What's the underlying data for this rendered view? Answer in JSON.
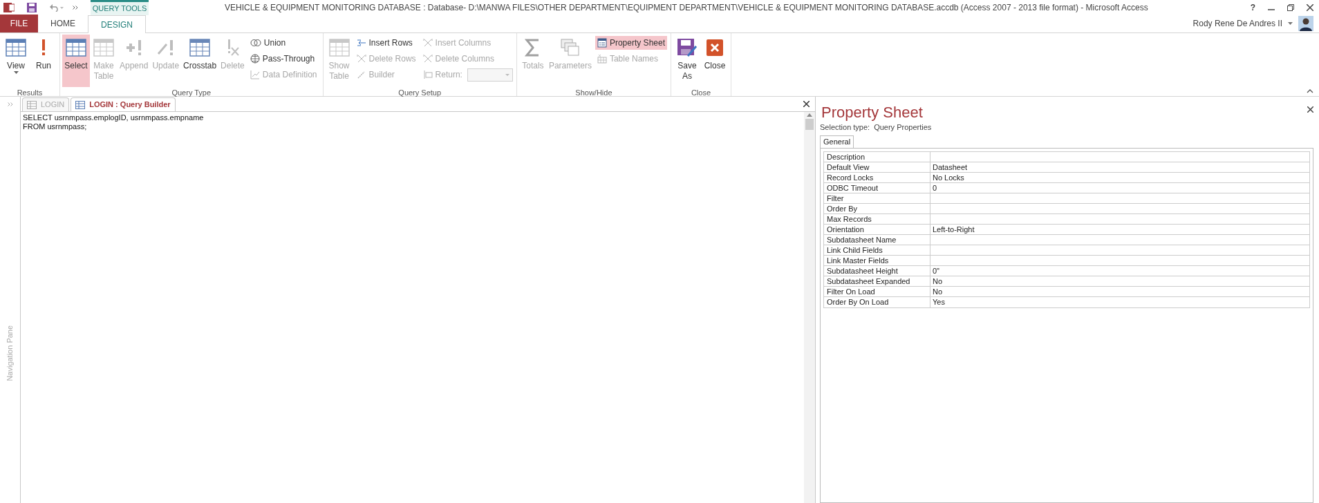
{
  "window": {
    "title": "VEHICLE & EQUIPMENT MONITORING DATABASE : Database- D:\\MANWA FILES\\OTHER DEPARTMENT\\EQUIPMENT DEPARTMENT\\VEHICLE & EQUIPMENT MONITORING DATABASE.accdb (Access 2007 - 2013 file format) - Microsoft Access",
    "context_tab": "QUERY TOOLS",
    "user": "Rody Rene De Andres II",
    "help": "?"
  },
  "ribbon_tabs": [
    {
      "label": "FILE",
      "kind": "file",
      "selected": false
    },
    {
      "label": "HOME",
      "kind": "tab",
      "selected": false
    },
    {
      "label": "DESIGN",
      "kind": "tab",
      "selected": true
    }
  ],
  "ribbon_groups": [
    {
      "label": "Results",
      "items": [
        {
          "kind": "large",
          "label": "View",
          "disabled": false,
          "selected": false,
          "dropdown": true
        },
        {
          "kind": "large",
          "label": "Run",
          "disabled": false,
          "selected": false
        }
      ]
    },
    {
      "label": "Query Type",
      "items": [
        {
          "kind": "large",
          "label": "Select",
          "disabled": false,
          "selected": true
        },
        {
          "kind": "large",
          "label": "Make Table",
          "disabled": true,
          "selected": false
        },
        {
          "kind": "large",
          "label": "Append",
          "disabled": true,
          "selected": false
        },
        {
          "kind": "large",
          "label": "Update",
          "disabled": true,
          "selected": false
        },
        {
          "kind": "large",
          "label": "Crosstab",
          "disabled": false,
          "selected": false
        },
        {
          "kind": "large",
          "label": "Delete",
          "disabled": true,
          "selected": false
        },
        {
          "kind": "stack",
          "items": [
            {
              "label": "Union",
              "disabled": false,
              "selected": false
            },
            {
              "label": "Pass-Through",
              "disabled": false,
              "selected": false
            },
            {
              "label": "Data Definition",
              "disabled": true,
              "selected": false
            }
          ]
        }
      ]
    },
    {
      "label": "Query Setup",
      "items": [
        {
          "kind": "large",
          "label": "Show Table",
          "disabled": true,
          "selected": false
        },
        {
          "kind": "stack",
          "items": [
            {
              "label": "Insert Rows",
              "disabled": false,
              "selected": false
            },
            {
              "label": "Delete Rows",
              "disabled": true,
              "selected": false
            },
            {
              "label": "Builder",
              "disabled": true,
              "selected": false
            }
          ]
        },
        {
          "kind": "stack",
          "items": [
            {
              "label": "Insert Columns",
              "disabled": true,
              "selected": false
            },
            {
              "label": "Delete Columns",
              "disabled": true,
              "selected": false
            },
            {
              "label": "Return:",
              "disabled": true,
              "selected": false,
              "combo": true
            }
          ]
        }
      ]
    },
    {
      "label": "Show/Hide",
      "items": [
        {
          "kind": "large",
          "label": "Totals",
          "disabled": true,
          "selected": false
        },
        {
          "kind": "large",
          "label": "Parameters",
          "disabled": true,
          "selected": false
        },
        {
          "kind": "stack",
          "items": [
            {
              "label": "Property Sheet",
              "disabled": false,
              "selected": true
            },
            {
              "label": "Table Names",
              "disabled": true,
              "selected": false
            }
          ]
        }
      ]
    },
    {
      "label": "Close",
      "items": [
        {
          "kind": "large",
          "label": "Save As",
          "disabled": false,
          "selected": false
        },
        {
          "kind": "large",
          "label": "Close",
          "disabled": false,
          "selected": false
        }
      ]
    }
  ],
  "navigation_pane": {
    "label": "Navigation Pane"
  },
  "document_tabs": [
    {
      "label": "LOGIN",
      "selected": false
    },
    {
      "label": "LOGIN : Query Builder",
      "selected": true
    }
  ],
  "sql_lines": [
    "SELECT usrnmpass.emplogID, usrnmpass.empname",
    "FROM usrnmpass;"
  ],
  "property_sheet": {
    "title": "Property Sheet",
    "selection_label": "Selection type:",
    "selection_value": "Query Properties",
    "tabs": [
      {
        "label": "General",
        "selected": true
      }
    ],
    "rows": [
      {
        "name": "Description",
        "value": ""
      },
      {
        "name": "Default View",
        "value": "Datasheet"
      },
      {
        "name": "Record Locks",
        "value": "No Locks"
      },
      {
        "name": "ODBC Timeout",
        "value": "0"
      },
      {
        "name": "Filter",
        "value": ""
      },
      {
        "name": "Order By",
        "value": ""
      },
      {
        "name": "Max Records",
        "value": ""
      },
      {
        "name": "Orientation",
        "value": "Left-to-Right"
      },
      {
        "name": "Subdatasheet Name",
        "value": ""
      },
      {
        "name": "Link Child Fields",
        "value": ""
      },
      {
        "name": "Link Master Fields",
        "value": ""
      },
      {
        "name": "Subdatasheet Height",
        "value": "0\""
      },
      {
        "name": "Subdatasheet Expanded",
        "value": "No"
      },
      {
        "name": "Filter On Load",
        "value": "No"
      },
      {
        "name": "Order By On Load",
        "value": "Yes"
      }
    ]
  }
}
